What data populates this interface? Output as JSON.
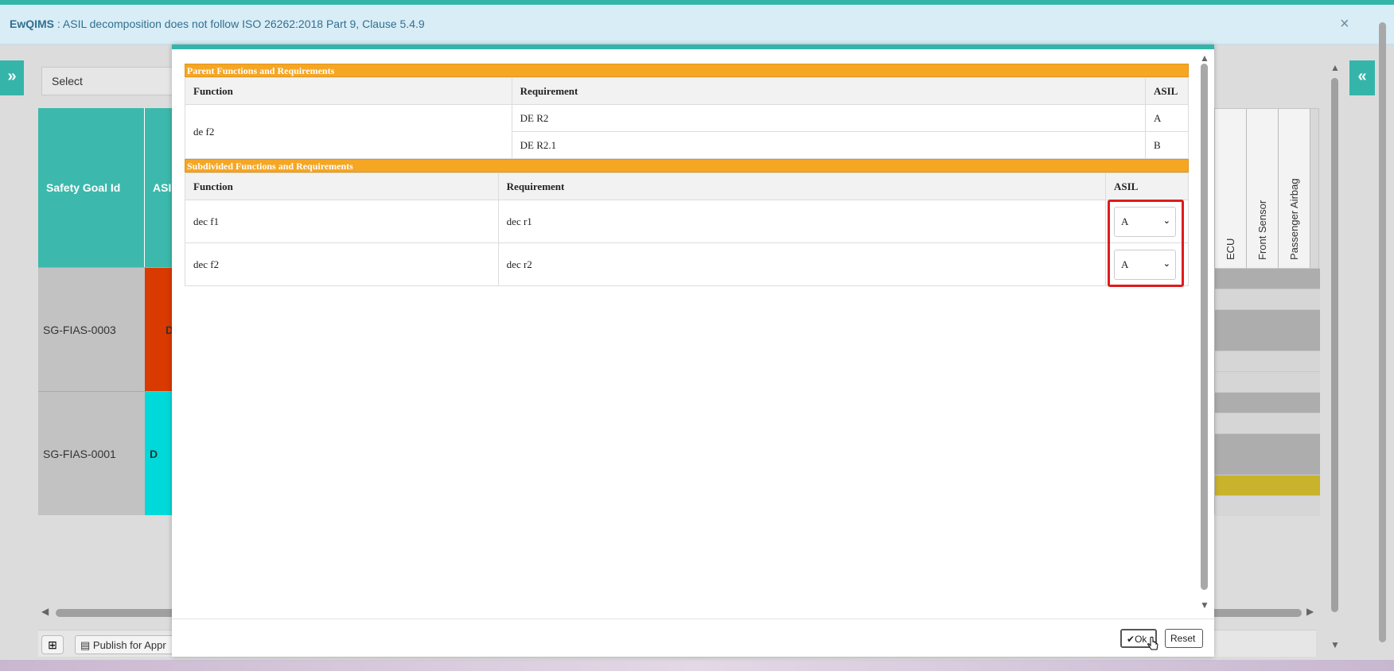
{
  "notification": {
    "app": "EwQIMS",
    "separator": " : ",
    "message": "ASIL decomposition does not follow ISO 26262:2018 Part 9, Clause 5.4.9",
    "close": "×"
  },
  "background": {
    "left_toggle": "»",
    "right_toggle": "«",
    "select_placeholder": "Select",
    "table": {
      "headers": [
        "Safety Goal Id",
        "ASI"
      ],
      "rows": [
        {
          "id": "SG-FIAS-0003",
          "asil": "D",
          "asil_color": "#d93a00"
        },
        {
          "id": "SG-FIAS-0001",
          "asil": "D",
          "asil_color": "#00d9d9"
        }
      ]
    },
    "right_columns": [
      "ECU",
      "Front Sensor",
      "Passenger Airbag"
    ],
    "bottom_bar": {
      "grid_icon": "⊞",
      "publish_label": "Publish for Appr"
    }
  },
  "modal": {
    "parent_section": {
      "title": "Parent Functions and Requirements",
      "headers": {
        "function": "Function",
        "requirement": "Requirement",
        "asil": "ASIL"
      },
      "function": "de f2",
      "rows": [
        {
          "requirement": "DE R2",
          "asil": "A"
        },
        {
          "requirement": "DE R2.1",
          "asil": "B"
        }
      ]
    },
    "subdivided_section": {
      "title": "Subdivided Functions and Requirements",
      "headers": {
        "function": "Function",
        "requirement": "Requirement",
        "asil": "ASIL"
      },
      "rows": [
        {
          "function": "dec f1",
          "requirement": "dec r1",
          "asil": "A"
        },
        {
          "function": "dec f2",
          "requirement": "dec r2",
          "asil": "A"
        }
      ]
    },
    "footer": {
      "ok_label": "Ok",
      "ok_icon": "✔",
      "reset_label": "Reset"
    }
  },
  "colors": {
    "teal": "#35b5aa",
    "section_orange": "#f5a623",
    "highlight_red": "#e01b1b",
    "notice_bg": "#d9edf7"
  }
}
